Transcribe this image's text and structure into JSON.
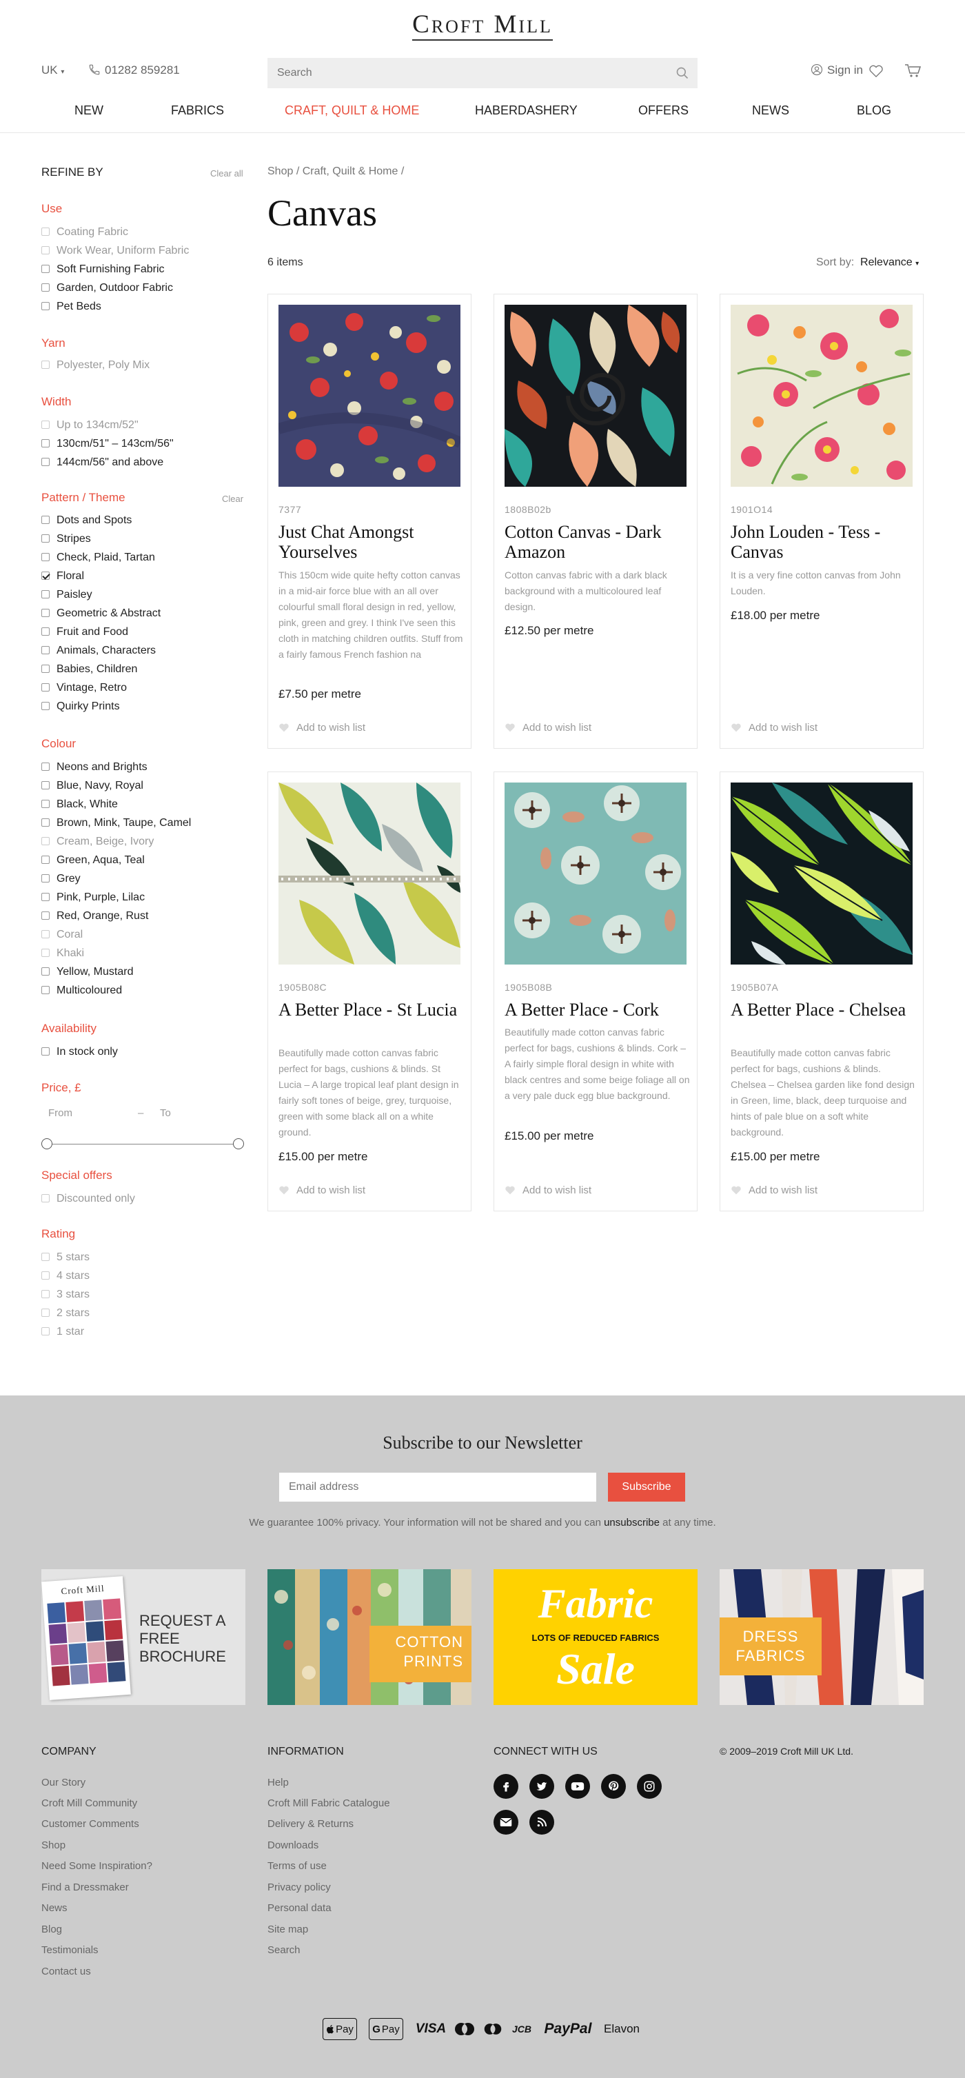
{
  "header": {
    "logo": "Croft Mill",
    "region": "UK",
    "phone": "01282 859281",
    "search_placeholder": "Search",
    "signin": "Sign in"
  },
  "nav": [
    "NEW",
    "FABRICS",
    "CRAFT, QUILT & HOME",
    "HABERDASHERY",
    "OFFERS",
    "NEWS",
    "BLOG"
  ],
  "nav_active": "CRAFT, QUILT & HOME",
  "sidebar": {
    "refine_by": "REFINE BY",
    "clear_all": "Clear all",
    "clear": "Clear",
    "use": {
      "title": "Use",
      "options": [
        "Coating Fabric",
        "Work Wear, Uniform Fabric",
        "Soft Furnishing Fabric",
        "Garden, Outdoor Fabric",
        "Pet Beds"
      ]
    },
    "yarn": {
      "title": "Yarn",
      "options": [
        "Polyester, Poly Mix"
      ]
    },
    "width": {
      "title": "Width",
      "options": [
        "Up to 134cm/52\"",
        "130cm/51\" – 143cm/56\"",
        "144cm/56\" and above"
      ]
    },
    "pattern": {
      "title": "Pattern / Theme",
      "options": [
        "Dots and Spots",
        "Stripes",
        "Check, Plaid, Tartan",
        "Floral",
        "Paisley",
        "Geometric & Abstract",
        "Fruit and Food",
        "Animals, Characters",
        "Babies, Children",
        "Vintage, Retro",
        "Quirky Prints"
      ]
    },
    "colour": {
      "title": "Colour",
      "options": [
        "Neons and Brights",
        "Blue, Navy, Royal",
        "Black, White",
        "Brown, Mink, Taupe, Camel",
        "Cream, Beige, Ivory",
        "Green, Aqua, Teal",
        "Grey",
        "Pink, Purple, Lilac",
        "Red, Orange, Rust",
        "Coral",
        "Khaki",
        "Yellow, Mustard",
        "Multicoloured"
      ]
    },
    "availability": {
      "title": "Availability",
      "options": [
        "In stock only"
      ]
    },
    "price": {
      "title": "Price, £",
      "from": "From",
      "dash": "–",
      "to": "To"
    },
    "offers": {
      "title": "Special offers",
      "options": [
        "Discounted only"
      ]
    },
    "rating": {
      "title": "Rating",
      "options": [
        "5 stars",
        "4 stars",
        "3 stars",
        "2 stars",
        "1 star"
      ]
    }
  },
  "main": {
    "breadcrumb": "Shop  /  Craft, Quilt & Home  /",
    "title": "Canvas",
    "items_count": "6 items",
    "sort_label": "Sort by:",
    "sort_value": "Relevance"
  },
  "products": [
    {
      "code": "7377",
      "name": "Just Chat Amongst Yourselves",
      "desc": "This 150cm wide quite hefty cotton canvas in a mid-air force blue with an all over colourful small floral design in red, yellow, pink, green and grey. I think I've seen this cloth in matching children outfits. Stuff from a fairly famous French fashion na",
      "price": "£7.50 per metre",
      "wish": "Add to wish list"
    },
    {
      "code": "1808B02b",
      "name": "Cotton Canvas - Dark Amazon",
      "desc": "Cotton canvas fabric with a dark black background with a multicoloured leaf design.",
      "price": "£12.50 per metre",
      "wish": "Add to wish list"
    },
    {
      "code": "1901O14",
      "name": "John Louden - Tess - Canvas",
      "desc": "It is a very fine cotton canvas from John Louden.",
      "price": "£18.00 per metre",
      "wish": "Add to wish list"
    },
    {
      "code": "1905B08C",
      "name": "A Better Place - St Lucia",
      "desc": "Beautifully made cotton canvas fabric perfect for bags, cushions & blinds. St Lucia – A large tropical leaf plant design in fairly soft tones of beige, grey, turquoise, green with some black all on a white ground.",
      "price": "£15.00 per metre",
      "wish": "Add to wish list"
    },
    {
      "code": "1905B08B",
      "name": "A Better Place - Cork",
      "desc": "Beautifully made cotton canvas fabric perfect for bags, cushions & blinds. Cork – A fairly simple floral design in white with black centres and some beige foliage all on a very pale duck egg blue background.",
      "price": "£15.00 per metre",
      "wish": "Add to wish list"
    },
    {
      "code": "1905B07A",
      "name": "A Better Place - Chelsea",
      "desc": "Beautifully made cotton canvas fabric perfect for bags, cushions & blinds. Chelsea – Chelsea garden like fond design in Green, lime, black, deep turquoise and hints of pale blue on a soft white background.",
      "price": "£15.00 per metre",
      "wish": "Add to wish list"
    }
  ],
  "newsletter": {
    "title": "Subscribe to our Newsletter",
    "placeholder": "Email address",
    "button": "Subscribe",
    "privacy_before": "We guarantee 100% privacy. Your information will not be shared and you can ",
    "privacy_link": "unsubscribe",
    "privacy_after": " at any time."
  },
  "promos": {
    "brochure": "REQUEST A FREE BROCHURE",
    "brochure_cover": "Croft Mill",
    "cotton": "COTTON PRINTS",
    "sale_top": "Fabric",
    "sale_mid": "LOTS OF REDUCED FABRICS",
    "sale_bottom": "Sale",
    "dress": "DRESS FABRICS"
  },
  "footer": {
    "company": {
      "title": "COMPANY",
      "links": [
        "Our Story",
        "Croft Mill Community",
        "Customer Comments",
        "Shop",
        "Need Some Inspiration?",
        "Find a Dressmaker",
        "News",
        "Blog",
        "Testimonials",
        "Contact us"
      ]
    },
    "information": {
      "title": "INFORMATION",
      "links": [
        "Help",
        "Croft Mill Fabric Catalogue",
        "Delivery & Returns",
        "Downloads",
        "Terms of use",
        "Privacy policy",
        "Personal data",
        "Site map",
        "Search"
      ]
    },
    "connect": {
      "title": "CONNECT WITH US",
      "icons": [
        "facebook-icon",
        "twitter-icon",
        "youtube-icon",
        "pinterest-icon",
        "instagram-icon",
        "email-icon",
        "rss-icon"
      ]
    },
    "copyright": "© 2009–2019  Croft Mill UK Ltd.",
    "payments": {
      "apple_pay": "Pay",
      "google_pay": "Pay",
      "visa": "VISA",
      "jcb": "JCB",
      "paypal": "PayPal",
      "elavon": "Elavon"
    }
  },
  "colors": {
    "accent": "#e8503f",
    "footer_bg": "#cccccc",
    "sale_yellow": "#ffd200",
    "label_orange": "#f3b13a"
  }
}
